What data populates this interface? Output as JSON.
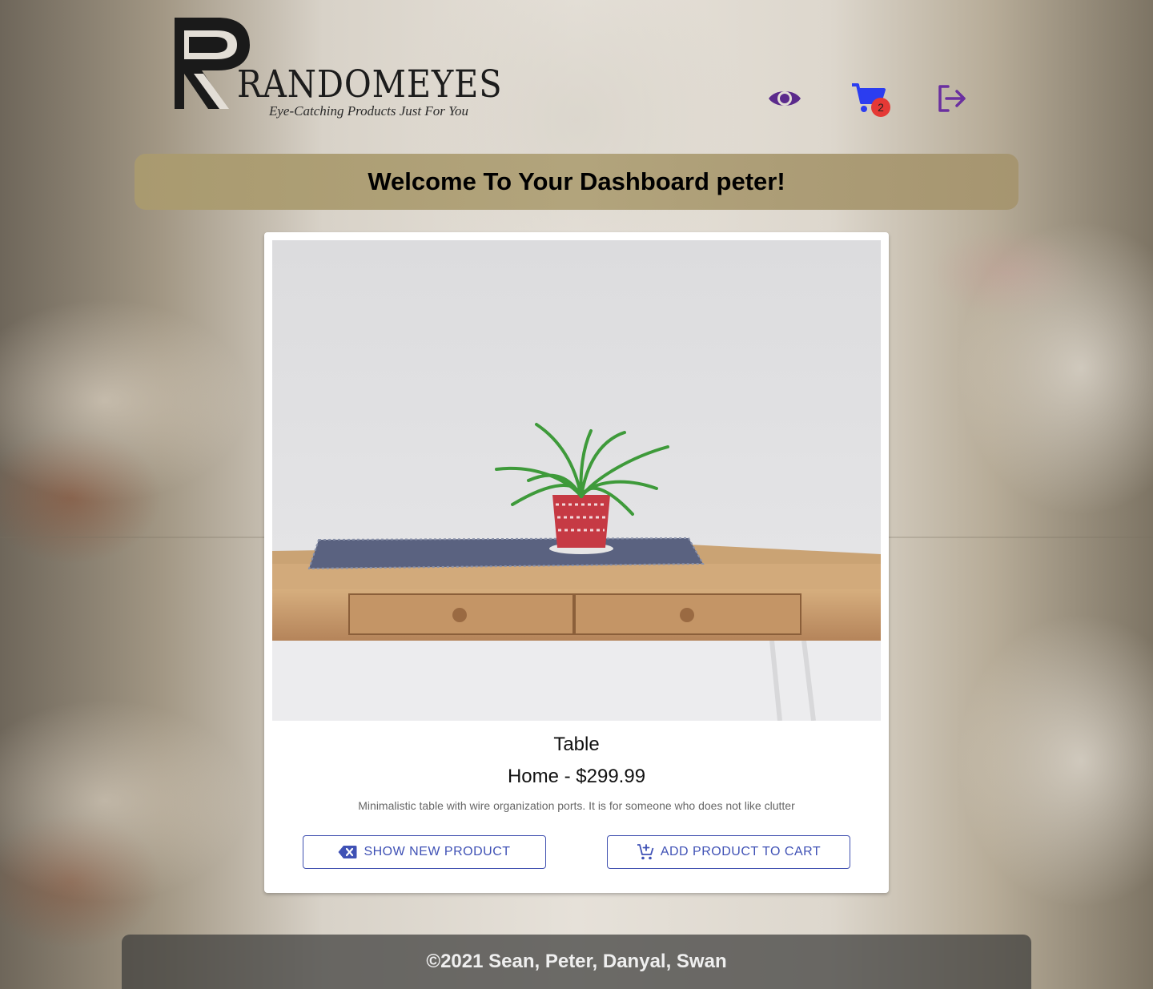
{
  "brand": {
    "logo_text": "RANDOMEYES",
    "tagline": "Eye-Catching Products Just For You"
  },
  "nav": {
    "items": [
      {
        "icon": "eye-icon",
        "color": "#5b2a8c"
      },
      {
        "icon": "cart-icon",
        "color": "#2b3df0"
      },
      {
        "icon": "logout-icon",
        "color": "#6a2fa0"
      }
    ],
    "cart_count": "2"
  },
  "welcome": {
    "title": "Welcome To Your Dashboard peter!"
  },
  "product": {
    "name": "Table",
    "category_price": "Home - $299.99",
    "description": "Minimalistic table with wire organization ports. It is for someone who does not like clutter",
    "image_alt": "Wooden table with a potted spider plant on a woven runner"
  },
  "actions": {
    "show_new_label": "SHOW NEW PRODUCT",
    "add_to_cart_label": "ADD PRODUCT TO CART"
  },
  "footer": {
    "copyright": "©2021 Sean, Peter, Danyal, Swan"
  },
  "colors": {
    "accent": "#3f51b5",
    "badge": "#e53935",
    "banner": "#ac9d74"
  }
}
